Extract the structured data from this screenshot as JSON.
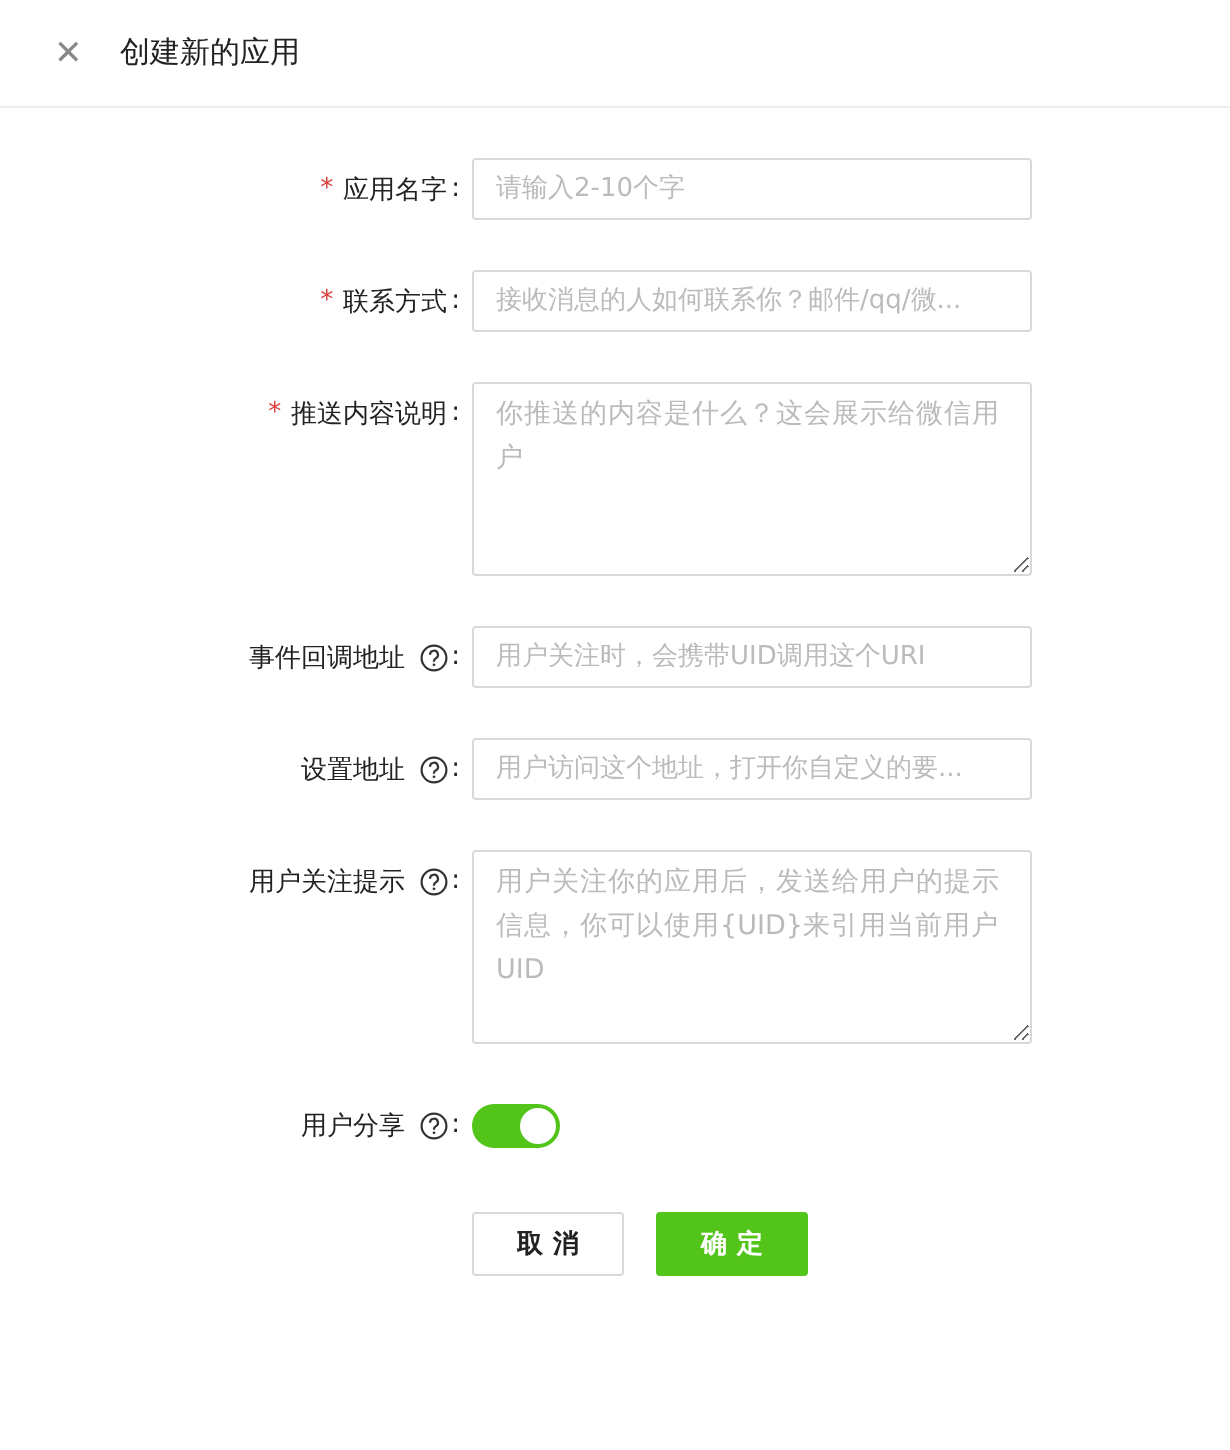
{
  "header": {
    "close_glyph": "✕",
    "title": "创建新的应用"
  },
  "fields": [
    {
      "kind": "input",
      "marker": "*",
      "label": "应用名字",
      "help": false,
      "colon": ":",
      "placeholder": "请输入2-10个字"
    },
    {
      "kind": "input",
      "marker": "*",
      "label": "联系方式",
      "help": false,
      "colon": ":",
      "placeholder": "接收消息的人如何联系你？邮件/qq/微..."
    },
    {
      "kind": "textarea",
      "marker": "*",
      "label": "推送内容说明",
      "help": false,
      "colon": ":",
      "placeholder": "你推送的内容是什么？这会展示给微信用户"
    },
    {
      "kind": "input",
      "label": "事件回调地址",
      "help": true,
      "colon": ":",
      "placeholder": "用户关注时，会携带UID调用这个URI"
    },
    {
      "kind": "input",
      "label": "设置地址",
      "help": true,
      "colon": ":",
      "placeholder": "用户访问这个地址，打开你自定义的要..."
    },
    {
      "kind": "textarea",
      "label": "用户关注提示",
      "help": true,
      "colon": ":",
      "placeholder": "用户关注你的应用后，发送给用户的提示信息，你可以使用{UID}来引用当前用户UID"
    },
    {
      "kind": "switch",
      "label": "用户分享",
      "help": true,
      "colon": ":",
      "on": true
    }
  ],
  "buttons": [
    {
      "kind": "default",
      "label": "取 消"
    },
    {
      "kind": "primary",
      "label": "确 定"
    }
  ]
}
